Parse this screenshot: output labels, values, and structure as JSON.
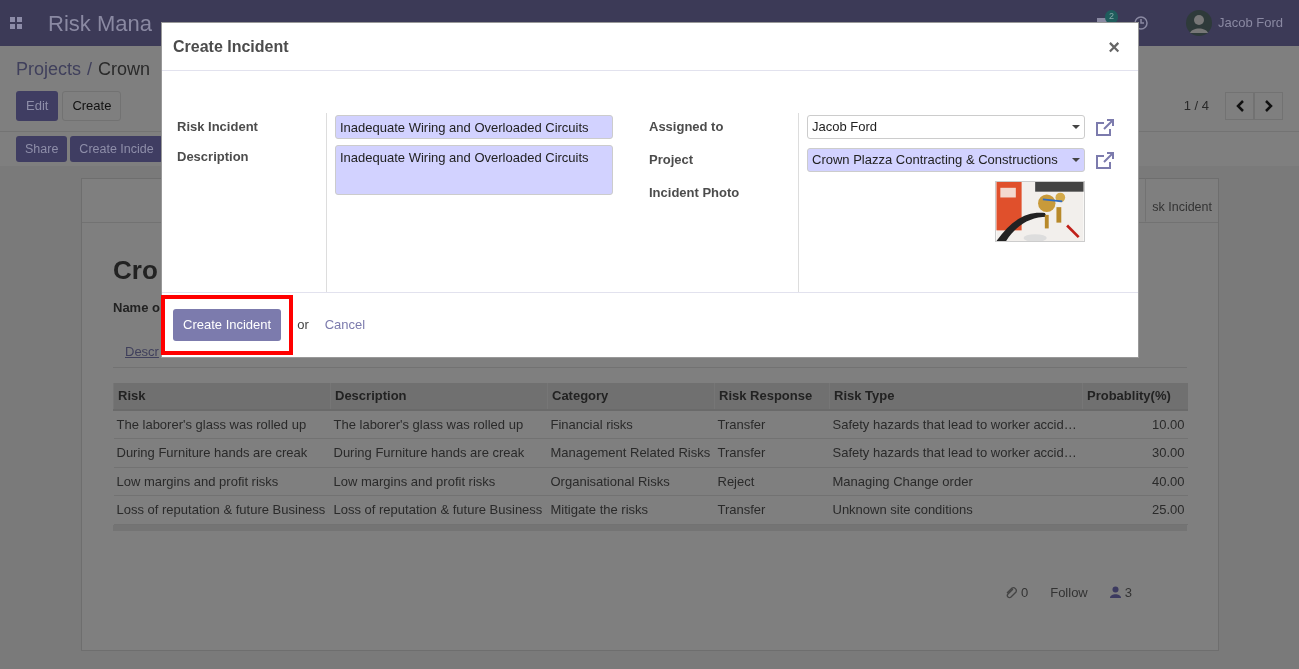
{
  "navbar": {
    "app_title": "Risk Mana",
    "message_count": "2",
    "user": "Jacob Ford"
  },
  "control_panel": {
    "breadcrumbs": [
      "Projects",
      "Crown"
    ],
    "breadcrumb_separator": "/",
    "buttons": [
      {
        "label": "Edit",
        "kind": "primary"
      },
      {
        "label": "Create",
        "kind": "secondary"
      }
    ],
    "pager": "1 / 4"
  },
  "action_bar": {
    "buttons": [
      "Share",
      "Create Incide"
    ]
  },
  "sheet": {
    "header_button": "sk Incident",
    "title": "Cro",
    "field_label": "Name o",
    "tab": "Descr",
    "table": {
      "columns": [
        "Risk",
        "Description",
        "Category",
        "Risk Response",
        "Risk Type",
        "Probablity(%)"
      ],
      "rows": [
        [
          "The laborer's glass was rolled up",
          "The laborer's glass was rolled up",
          "Financial risks",
          "Transfer",
          "Safety hazards that lead to worker accid…",
          "10.00"
        ],
        [
          "During Furniture hands are creak",
          "During Furniture hands are creak",
          "Management Related Risks",
          "Transfer",
          "Safety hazards that lead to worker accid…",
          "30.00"
        ],
        [
          "Low margins and profit risks",
          "Low margins and profit risks",
          "Organisational Risks",
          "Reject",
          "Managing Change order",
          "40.00"
        ],
        [
          "Loss of reputation & future Business",
          "Loss of reputation & future Business",
          "Mitigate the risks",
          "Transfer",
          "Unknown site conditions",
          "25.00"
        ]
      ]
    }
  },
  "chatter": {
    "attachments": "0",
    "follow": "Follow",
    "followers": "3"
  },
  "modal": {
    "title": "Create Incident",
    "close": "×",
    "left_fields": [
      {
        "label": "Risk Incident",
        "kind": "text",
        "value": "Inadequate Wiring and Overloaded Circuits",
        "required": true
      },
      {
        "label": "Description",
        "kind": "textarea",
        "value": "Inadequate Wiring and Overloaded Circuits",
        "required": true
      }
    ],
    "right_fields": [
      {
        "label": "Assigned to",
        "kind": "select",
        "value": "Jacob Ford",
        "required": false
      },
      {
        "label": "Project",
        "kind": "select",
        "value": "Crown Plazza Contracting & Constructions",
        "required": true
      },
      {
        "label": "Incident Photo",
        "kind": "picture"
      }
    ],
    "primary_button": "Create Incident",
    "highlighted": true,
    "or": "or",
    "cancel": "Cancel"
  }
}
